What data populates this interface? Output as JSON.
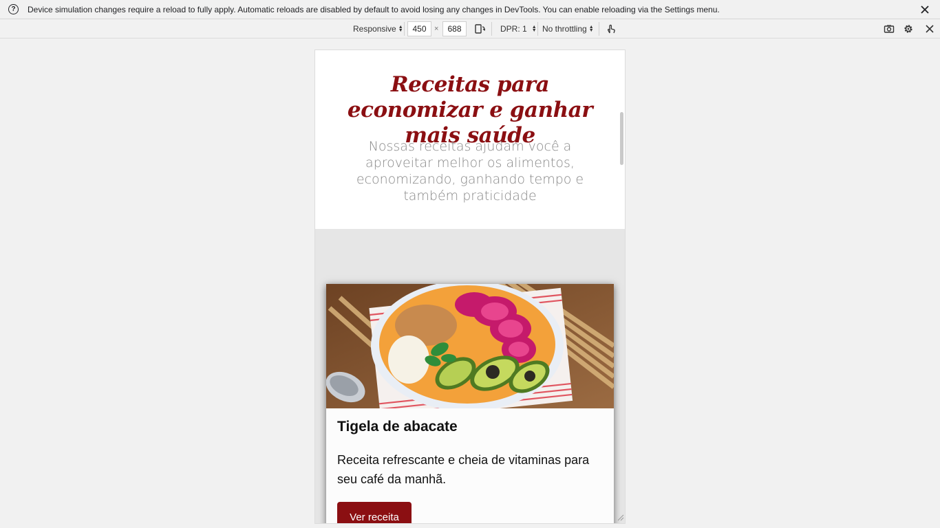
{
  "infobar": {
    "message": "Device simulation changes require a reload to fully apply. Automatic reloads are disabled by default to avoid losing any changes in DevTools. You can enable reloading via the Settings menu.",
    "help_icon": "question-circle-icon",
    "close_icon": "close-icon"
  },
  "toolbar": {
    "device_mode": "Responsive",
    "width": "450",
    "times": "×",
    "height": "688",
    "rotate_icon": "rotate-icon",
    "dpr": "DPR: 1",
    "throttling": "No throttling",
    "touch_icon": "touch-icon",
    "screenshot_icon": "camera-icon",
    "settings_icon": "gear-icon",
    "close_icon": "close-icon"
  },
  "page": {
    "title": "Receitas para economizar e ganhar mais saúde",
    "subtitle": "Nossas receitas ajudam você a aproveitar melhor os alimentos, economizando, ganhando tempo e também praticidade",
    "card": {
      "image_alt": "Tigela de abacate",
      "title": "Tigela de abacate",
      "description": "Receita refrescante e cheia de vitaminas para seu café da manhã.",
      "button_label": "Ver receita"
    }
  },
  "colors": {
    "brand": "#8b0f12",
    "subtitle": "#888888",
    "section_bg": "#e6e6e6"
  }
}
